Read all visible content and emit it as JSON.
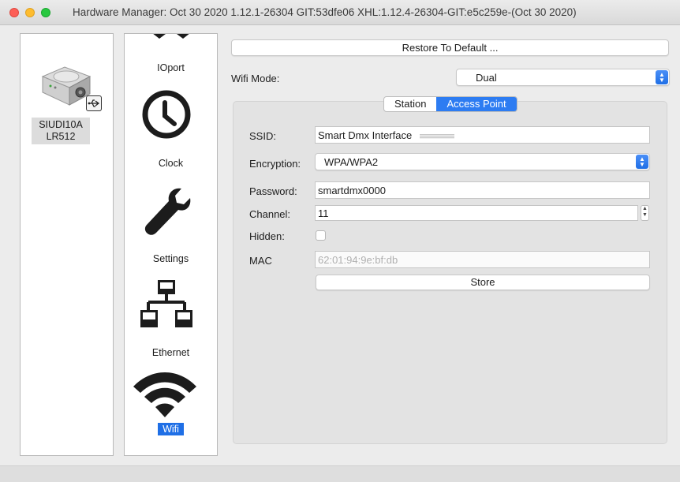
{
  "window": {
    "title": "Hardware Manager: Oct 30 2020 1.12.1-26304 GIT:53dfe06 XHL:1.12.4-26304-GIT:e5c259e-(Oct 30 2020)"
  },
  "device": {
    "name_line1": "SIUDI10A",
    "name_line2": "LR512",
    "icon": "usb-icon"
  },
  "nav": {
    "items": [
      {
        "label": "IOport",
        "icon": "ioport-icon"
      },
      {
        "label": "Clock",
        "icon": "clock-icon"
      },
      {
        "label": "Settings",
        "icon": "wrench-icon"
      },
      {
        "label": "Ethernet",
        "icon": "network-icon"
      },
      {
        "label": "Wifi",
        "icon": "wifi-icon",
        "selected": true
      }
    ]
  },
  "main": {
    "restore_label": "Restore To Default ...",
    "wifi_mode_label": "Wifi Mode:",
    "wifi_mode_value": "Dual",
    "tabs": [
      {
        "label": "Station"
      },
      {
        "label": "Access Point",
        "active": true
      }
    ],
    "ssid_label": "SSID:",
    "ssid_value": "Smart Dmx Interface",
    "encryption_label": "Encryption:",
    "encryption_value": "WPA/WPA2",
    "password_label": "Password:",
    "password_value": "smartdmx0000",
    "channel_label": "Channel:",
    "channel_value": "11",
    "hidden_label": "Hidden:",
    "hidden_checked": false,
    "mac_label": "MAC",
    "mac_value": "62:01:94:9e:bf:db",
    "store_label": "Store"
  },
  "colors": {
    "accent": "#1f6fe6",
    "window_bg": "#ececec"
  }
}
